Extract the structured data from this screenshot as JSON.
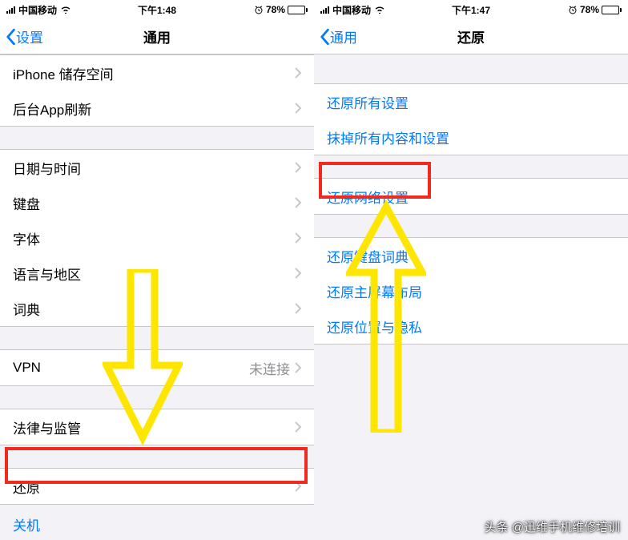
{
  "left": {
    "status": {
      "carrier": "中国移动",
      "time": "下午1:48",
      "battery_pct": "78%"
    },
    "nav": {
      "back": "设置",
      "title": "通用"
    },
    "rows": {
      "storage": "iPhone 储存空间",
      "bgRefresh": "后台App刷新",
      "dateTime": "日期与时间",
      "keyboard": "键盘",
      "font": "字体",
      "langRegion": "语言与地区",
      "dictionary": "词典",
      "vpn": "VPN",
      "vpn_value": "未连接",
      "legal": "法律与监管",
      "reset": "还原",
      "shutdown": "关机"
    }
  },
  "right": {
    "status": {
      "carrier": "中国移动",
      "time": "下午1:47",
      "battery_pct": "78%"
    },
    "nav": {
      "back": "通用",
      "title": "还原"
    },
    "rows": {
      "resetAll": "还原所有设置",
      "eraseAll": "抹掉所有内容和设置",
      "resetNetwork": "还原网络设置",
      "resetKeyboard": "还原键盘词典",
      "resetHome": "还原主屏幕布局",
      "resetLocation": "还原位置与隐私"
    }
  },
  "watermark": "头条 @迅维手机维修培训"
}
